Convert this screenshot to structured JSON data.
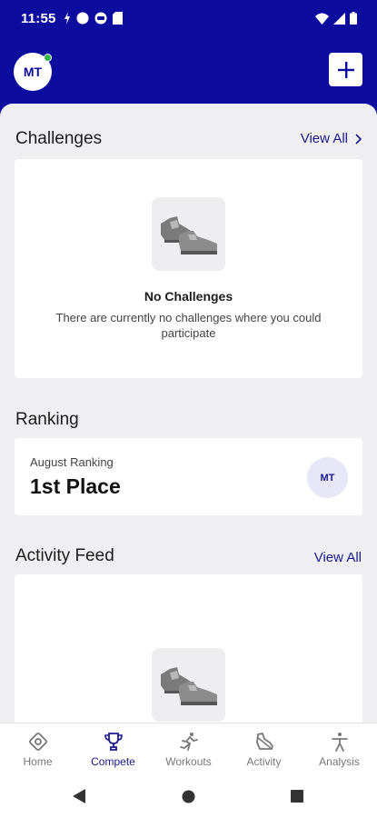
{
  "status": {
    "time": "11:55"
  },
  "header": {
    "avatar_initials": "MT"
  },
  "challenges": {
    "title": "Challenges",
    "view_all": "View All",
    "empty_title": "No Challenges",
    "empty_desc": "There are currently no challenges where you could participate"
  },
  "ranking": {
    "title": "Ranking",
    "period": "August Ranking",
    "place": "1st Place",
    "avatar_initials": "MT"
  },
  "feed": {
    "title": "Activity Feed",
    "view_all": "View All"
  },
  "nav": {
    "items": [
      {
        "label": "Home",
        "icon": "home-icon"
      },
      {
        "label": "Compete",
        "icon": "trophy-icon",
        "active": true
      },
      {
        "label": "Workouts",
        "icon": "running-icon"
      },
      {
        "label": "Activity",
        "icon": "shoe-icon"
      },
      {
        "label": "Analysis",
        "icon": "person-icon"
      }
    ]
  },
  "colors": {
    "brand": "#0c0c9e",
    "accent": "#1a1a8c",
    "background": "#efeff1"
  }
}
